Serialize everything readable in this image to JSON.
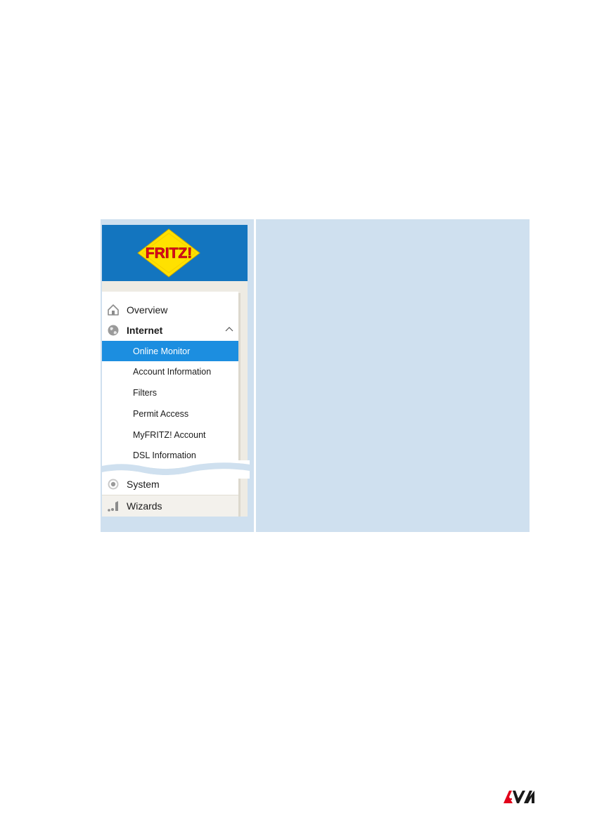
{
  "logo": {
    "text": "FRITZ!"
  },
  "menu": {
    "overview": {
      "label": "Overview",
      "icon": "home-icon"
    },
    "internet": {
      "label": "Internet",
      "icon": "globe-icon",
      "expanded": true,
      "items": [
        {
          "label": "Online Monitor",
          "active": true
        },
        {
          "label": "Account Information",
          "active": false
        },
        {
          "label": "Filters",
          "active": false
        },
        {
          "label": "Permit Access",
          "active": false
        },
        {
          "label": "MyFRITZ! Account",
          "active": false
        },
        {
          "label": "DSL Information",
          "active": false
        }
      ]
    },
    "system": {
      "label": "System",
      "icon": "system-icon"
    },
    "wizards": {
      "label": "Wizards",
      "icon": "wizard-icon"
    }
  },
  "colors": {
    "header_blue": "#1375bf",
    "active_blue": "#1c8ee0",
    "content_bg": "#cfe0ef",
    "logo_yellow": "#ffe100",
    "logo_red": "#e2001a",
    "avm_red": "#e2001a"
  },
  "brand": {
    "vendor": "AVM"
  }
}
